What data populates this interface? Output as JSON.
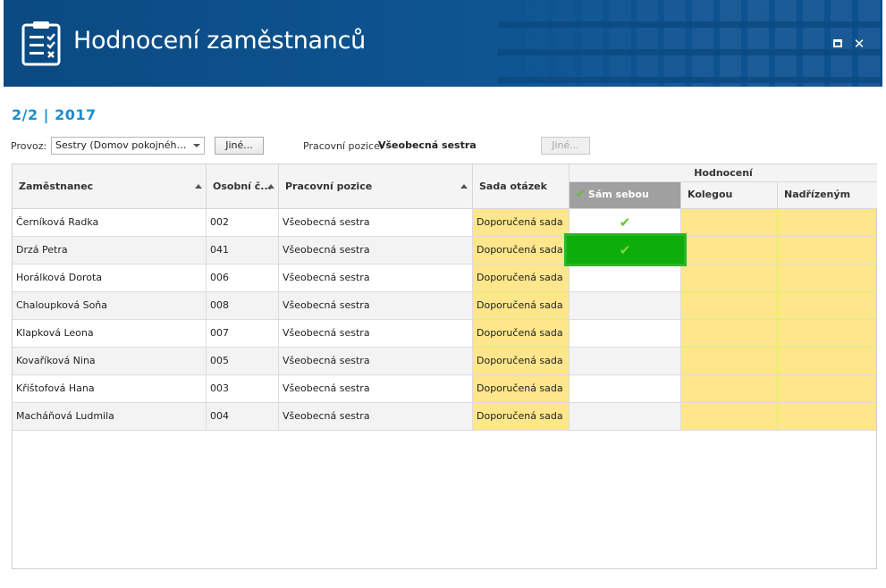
{
  "window": {
    "title": "Hodnocení zaměstnanců",
    "maximize_icon": "maximize-icon",
    "close_symbol": "✕",
    "titlebar_color": "#0e5592"
  },
  "period": "2/2 | 2017",
  "filters": {
    "provoz_label": "Provoz:",
    "provoz_value": "Sestry (Domov pokojného st...",
    "provoz_button": "Jiné...",
    "pozice_label": "Pracovní pozice:",
    "pozice_value": "Všeobecná sestra",
    "pozice_button": "Jiné..."
  },
  "grid": {
    "columns": {
      "employee": "Zaměstnanec",
      "number": "Osobní č...",
      "position": "Pracovní pozice",
      "question_set": "Sada otázek",
      "evaluation_group": "Hodnocení",
      "self": "Sám sebou",
      "colleagues": "Kolegou",
      "superior": "Nadřízeným"
    },
    "rows": [
      {
        "name": "Černíková Radka",
        "number": "002",
        "position": "Všeobecná sestra",
        "set": "Doporučená sada",
        "self_done": true
      },
      {
        "name": "Drzá Petra",
        "number": "041",
        "position": "Všeobecná sestra",
        "set": "Doporučená sada",
        "self_done": true
      },
      {
        "name": "Horálková Dorota",
        "number": "006",
        "position": "Všeobecná sestra",
        "set": "Doporučená sada",
        "self_done": false
      },
      {
        "name": "Chaloupková Soňa",
        "number": "008",
        "position": "Všeobecná sestra",
        "set": "Doporučená sada",
        "self_done": false
      },
      {
        "name": "Klapková Leona",
        "number": "007",
        "position": "Všeobecná sestra",
        "set": "Doporučená sada",
        "self_done": false
      },
      {
        "name": "Kovaříková Nina",
        "number": "005",
        "position": "Všeobecná sestra",
        "set": "Doporučená sada",
        "self_done": false
      },
      {
        "name": "Křištofová Hana",
        "number": "003",
        "position": "Všeobecná sestra",
        "set": "Doporučená sada",
        "self_done": false
      },
      {
        "name": "Macháňová Ludmila",
        "number": "004",
        "position": "Všeobecná sestra",
        "set": "Doporučená sada",
        "self_done": false
      }
    ],
    "selected_row": 1,
    "check_symbol": "✔",
    "set_color": "#fde68b",
    "selected_color": "#0cae0c"
  }
}
